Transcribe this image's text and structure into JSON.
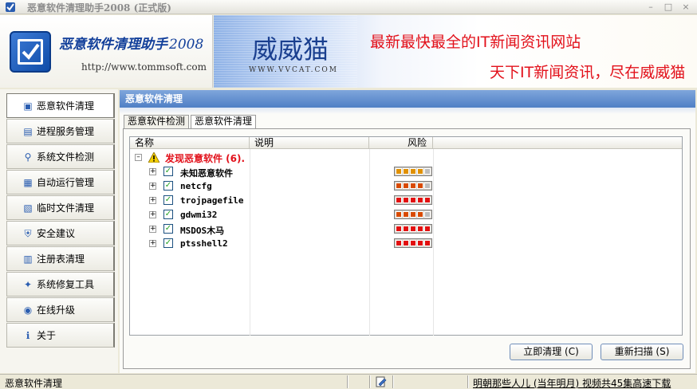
{
  "window": {
    "title": "恶意软件清理助手2008 (正式版)",
    "minimize_label": "–",
    "maximize_label": "□",
    "close_label": "×"
  },
  "banner": {
    "logo_name": "恶意软件清理助手",
    "logo_year": "2008",
    "logo_url": "http://www.tommsoft.com",
    "ad_brand": "威威猫",
    "ad_brand_url": "WWW.VVCAT.COM",
    "ad_line1": "最新最快最全的IT新闻资讯网站",
    "ad_line2": "天下IT新闻资讯，尽在威威猫"
  },
  "sidebar": {
    "items": [
      {
        "label": "恶意软件清理",
        "icon": "scan-icon"
      },
      {
        "label": "进程服务管理",
        "icon": "process-icon"
      },
      {
        "label": "系统文件检测",
        "icon": "magnifier-icon"
      },
      {
        "label": "自动运行管理",
        "icon": "autorun-icon"
      },
      {
        "label": "临时文件清理",
        "icon": "tempfile-icon"
      },
      {
        "label": "安全建议",
        "icon": "shield-icon"
      },
      {
        "label": "注册表清理",
        "icon": "registry-icon"
      },
      {
        "label": "系统修复工具",
        "icon": "repair-icon"
      },
      {
        "label": "在线升级",
        "icon": "globe-icon"
      },
      {
        "label": "关于",
        "icon": "info-icon"
      }
    ]
  },
  "main": {
    "header": "恶意软件清理",
    "tabs": [
      "恶意软件检测",
      "恶意软件清理"
    ],
    "columns": {
      "name": "名称",
      "desc": "说明",
      "risk": "风险"
    },
    "group": {
      "label": "发现恶意软件 (6)."
    },
    "items": [
      {
        "name": "未知恶意软件",
        "risk_level": 4,
        "risk_color": "#e09000"
      },
      {
        "name": "netcfg",
        "risk_level": 4,
        "risk_color": "#d84a00"
      },
      {
        "name": "trojpagefile",
        "risk_level": 5,
        "risk_color": "#e21010"
      },
      {
        "name": "gdwmi32",
        "risk_level": 4,
        "risk_color": "#d84a00"
      },
      {
        "name": "MSDOS木马",
        "risk_level": 5,
        "risk_color": "#e21010"
      },
      {
        "name": "ptsshell2",
        "risk_level": 5,
        "risk_color": "#e21010"
      }
    ],
    "buttons": {
      "clean": "立即清理 (C)",
      "rescan": "重新扫描 (S)"
    }
  },
  "statusbar": {
    "text": "恶意软件清理",
    "link": "明朝那些人儿 (当年明月) 视频共45集高速下载"
  }
}
